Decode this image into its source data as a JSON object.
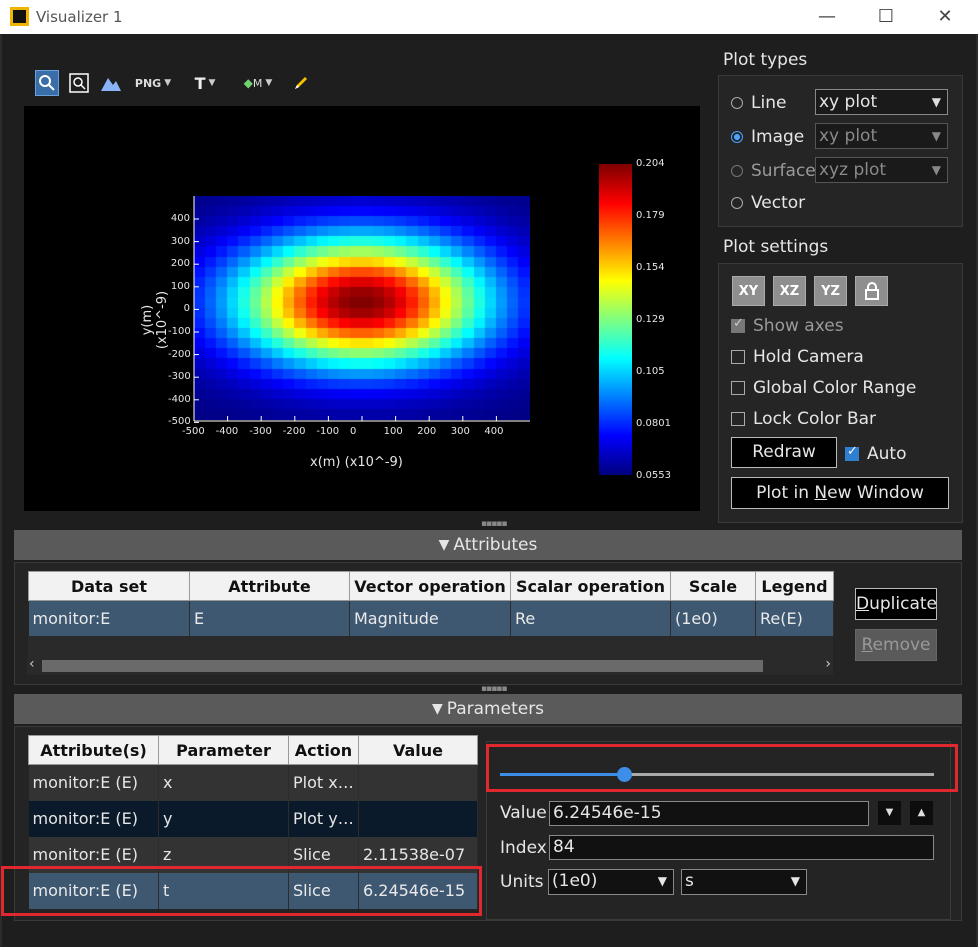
{
  "window": {
    "title": "Visualizer 1",
    "minimize": "—",
    "maximize": "☐",
    "close": "✕"
  },
  "toolbar": {
    "png": "PNG",
    "t": "T",
    "m": "M"
  },
  "plot": {
    "xlabel": "x(m) (x10^-9)",
    "ylabel": "y(m) (x10^-9)",
    "xticks": [
      "-500",
      "-400",
      "-300",
      "-200",
      "-100",
      "0",
      "100",
      "200",
      "300",
      "400"
    ],
    "yticks": [
      "400",
      "300",
      "200",
      "100",
      "0",
      "-100",
      "-200",
      "-300",
      "-400",
      "-500"
    ],
    "colorbar_ticks": [
      "0.204",
      "0.179",
      "0.154",
      "0.129",
      "0.105",
      "0.0801",
      "0.0553"
    ]
  },
  "chart_data": {
    "type": "heatmap",
    "title": "",
    "xlabel": "x(m) (x10^-9)",
    "ylabel": "y(m) (x10^-9)",
    "xlim": [
      -500,
      500
    ],
    "ylim": [
      -500,
      450
    ],
    "value_range": [
      0.0553,
      0.204
    ],
    "colormap": "jet",
    "peak": {
      "x": 0,
      "y": 0,
      "value": 0.204
    }
  },
  "plot_types": {
    "title": "Plot types",
    "line": {
      "label": "Line",
      "select": "xy plot"
    },
    "image": {
      "label": "Image",
      "select": "xy plot"
    },
    "surface": {
      "label": "Surface",
      "select": "xyz plot"
    },
    "vector": {
      "label": "Vector"
    }
  },
  "plot_settings": {
    "title": "Plot settings",
    "view_buttons": [
      "XY",
      "XZ",
      "YZ"
    ],
    "show_axes": "Show axes",
    "hold_camera": "Hold Camera",
    "global_color_range": "Global Color Range",
    "lock_color_bar": "Lock Color Bar",
    "redraw": "Redraw",
    "auto": "Auto",
    "plot_new_window": {
      "pre": "Plot in ",
      "u": "N",
      "post": "ew Window"
    }
  },
  "attributes": {
    "bar": "Attributes",
    "columns": [
      "Data set",
      "Attribute",
      "Vector operation",
      "Scalar operation",
      "Scale",
      "Legend"
    ],
    "rows": [
      [
        "monitor:E",
        "E",
        "Magnitude",
        "Re",
        "(1e0)",
        "Re(E)"
      ]
    ],
    "duplicate": {
      "u": "D",
      "rest": "uplicate"
    },
    "remove": {
      "u": "R",
      "rest": "emove"
    }
  },
  "parameters": {
    "bar": "Parameters",
    "columns": [
      "Attribute(s)",
      "Parameter",
      "Action",
      "Value"
    ],
    "rows": [
      [
        "monitor:E (E)",
        "x",
        "Plot x…",
        ""
      ],
      [
        "monitor:E (E)",
        "y",
        "Plot y…",
        ""
      ],
      [
        "monitor:E (E)",
        "z",
        "Slice",
        "2.11538e-07"
      ],
      [
        "monitor:E (E)",
        "t",
        "Slice",
        "6.24546e-15"
      ]
    ],
    "slider_fraction": 0.286,
    "value_label": "Value",
    "value": "6.24546e-15",
    "index_label": "Index",
    "index": "84",
    "units_label": "Units",
    "units_scale": "(1e0)",
    "units": "s"
  },
  "colors": {
    "accent": "#3d8ee8",
    "highlight": "#e0282e",
    "selected_row": "#3e5872"
  }
}
